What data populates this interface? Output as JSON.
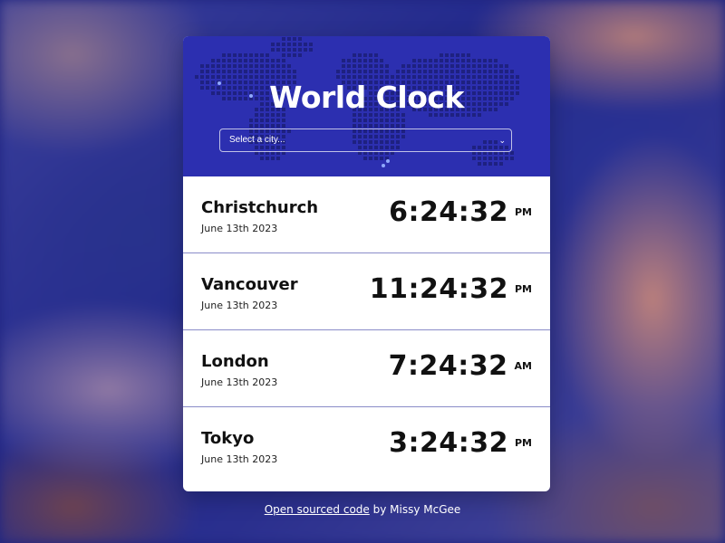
{
  "header": {
    "title": "World Clock",
    "select_placeholder": "Select a city...",
    "chevron_icon": "chevron-down-icon",
    "bg_color": "#2c2fb0"
  },
  "clocks": [
    {
      "city": "Christchurch",
      "date": "June 13th 2023",
      "time": "6:24:32",
      "period": "PM"
    },
    {
      "city": "Vancouver",
      "date": "June 13th 2023",
      "time": "11:24:32",
      "period": "PM"
    },
    {
      "city": "London",
      "date": "June 13th 2023",
      "time": "7:24:32",
      "period": "AM"
    },
    {
      "city": "Tokyo",
      "date": "June 13th 2023",
      "time": "3:24:32",
      "period": "PM"
    }
  ],
  "footer": {
    "link_text": "Open sourced code",
    "credit_text": " by Missy McGee"
  },
  "colors": {
    "accent": "#2c2fb0",
    "divider": "#8a8cc8"
  }
}
